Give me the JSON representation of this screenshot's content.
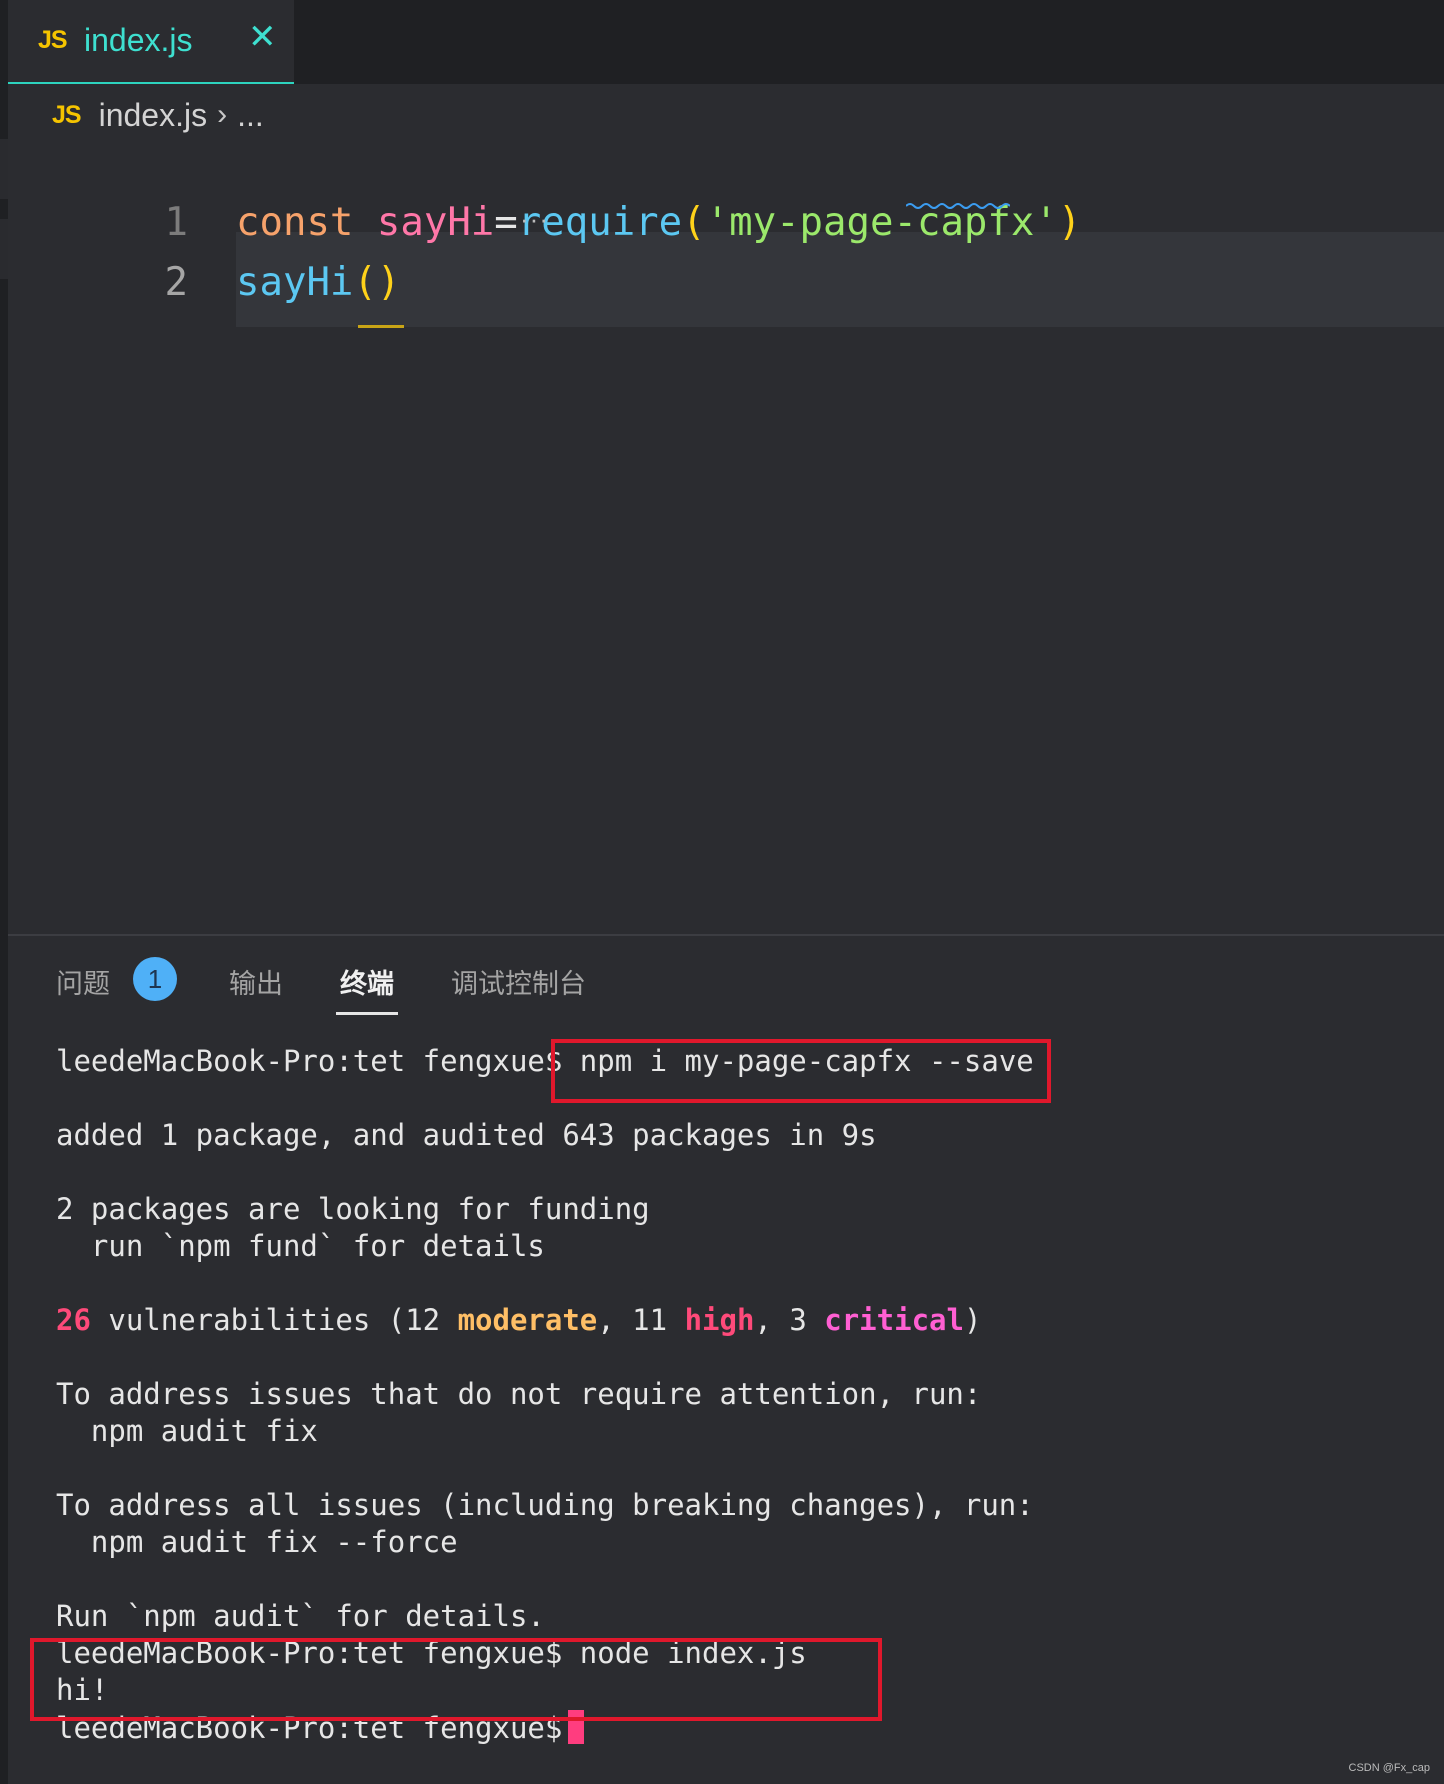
{
  "tab": {
    "badge": "JS",
    "title": "index.js",
    "close": "✕"
  },
  "breadcrumb": {
    "badge": "JS",
    "file": "index.js",
    "separator": "›",
    "more": "..."
  },
  "editor": {
    "lines": [
      {
        "number": "1",
        "tokens": {
          "keyword": "const ",
          "var": "sayHi",
          "op": "=",
          "fn": "require",
          "open": "(",
          "string": "'my-page-capfx'",
          "close": ")"
        }
      },
      {
        "number": "2",
        "tokens": {
          "fn": "sayHi",
          "parens": "()"
        }
      }
    ],
    "hint_dots": "···"
  },
  "panel": {
    "tabs": [
      {
        "label": "问题"
      },
      {
        "label": "输出"
      },
      {
        "label": "终端"
      },
      {
        "label": "调试控制台"
      }
    ],
    "problems_count": "1",
    "active_tab": "终端"
  },
  "terminal": {
    "prompt": "leedeMacBook-Pro:tet fengxue$",
    "cmd1": " npm i my-page-capfx --save",
    "out1": "added 1 package, and audited 643 packages in 9s",
    "out2": "2 packages are looking for funding",
    "out3": "  run `npm fund` for details",
    "vuln": {
      "count": "26",
      "text1": " vulnerabilities (12 ",
      "moderate": "moderate",
      "text2": ", 11 ",
      "high": "high",
      "text3": ", 3 ",
      "critical": "critical",
      "text4": ")"
    },
    "out5": "To address issues that do not require attention, run:",
    "out6": "  npm audit fix",
    "out7": "To address all issues (including breaking changes), run:",
    "out8": "  npm audit fix --force",
    "out9": "Run `npm audit` for details.",
    "cmd2_line": "leedeMacBook-Pro:tet fengxue$ node index.js",
    "result": "hi!",
    "prompt_last": "leedeMacBook-Pro:tet fengxue$"
  },
  "watermark": "CSDN @Fx_cap",
  "colors": {
    "accent_tab": "#2dd4bf",
    "highlight_box": "#e0182c",
    "problems_badge": "#4fb0f7"
  }
}
